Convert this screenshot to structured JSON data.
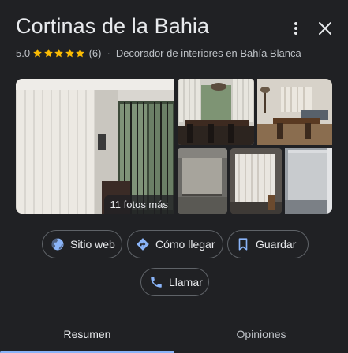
{
  "place": {
    "name": "Cortinas de la Bahia",
    "rating": "5.0",
    "stars": 5,
    "review_count": "(6)",
    "separator": "·",
    "category": "Decorador de interiores en Bahía Blanca"
  },
  "header": {
    "more_icon": "more-vertical-icon",
    "close_icon": "close-icon"
  },
  "photos": {
    "more_label": "11 fotos más"
  },
  "actions": {
    "website": {
      "label": "Sitio web",
      "icon": "globe-icon"
    },
    "directions": {
      "label": "Cómo llegar",
      "icon": "directions-icon"
    },
    "save": {
      "label": "Guardar",
      "icon": "bookmark-icon"
    },
    "call": {
      "label": "Llamar",
      "icon": "phone-icon"
    }
  },
  "tabs": [
    {
      "label": "Resumen",
      "selected": true
    },
    {
      "label": "Opiniones",
      "selected": false
    }
  ],
  "colors": {
    "background": "#202124",
    "text": "#e8eaed",
    "secondary_text": "#bdc1c6",
    "star": "#fbbc04",
    "accent": "#8ab4f8",
    "border": "#5f6368"
  }
}
